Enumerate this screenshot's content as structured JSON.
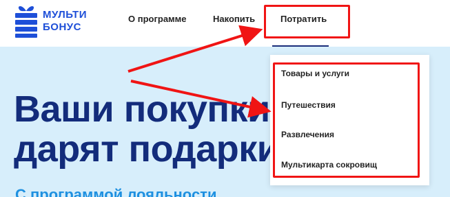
{
  "logo": {
    "line1": "МУЛЬТИ",
    "line2": "БОНУС",
    "icon": "gift-icon",
    "brand_color": "#1e4fd8"
  },
  "nav": {
    "about": "О программе",
    "save": "Накопить",
    "spend": "Потратить",
    "active_color": "#1a2d7a"
  },
  "hero": {
    "title_line1": "Ваши покупки",
    "title_line2": "дарят подарки",
    "subtitle": "С программой лояльности",
    "background": "#d7eefb",
    "title_color": "#132c7b",
    "subtitle_color": "#1e90e0"
  },
  "dropdown": {
    "items": [
      "Товары и услуги",
      "Путешествия",
      "Развлечения",
      "Мультикарта сокровищ"
    ]
  },
  "annotations": {
    "highlight_color": "#f01414"
  }
}
